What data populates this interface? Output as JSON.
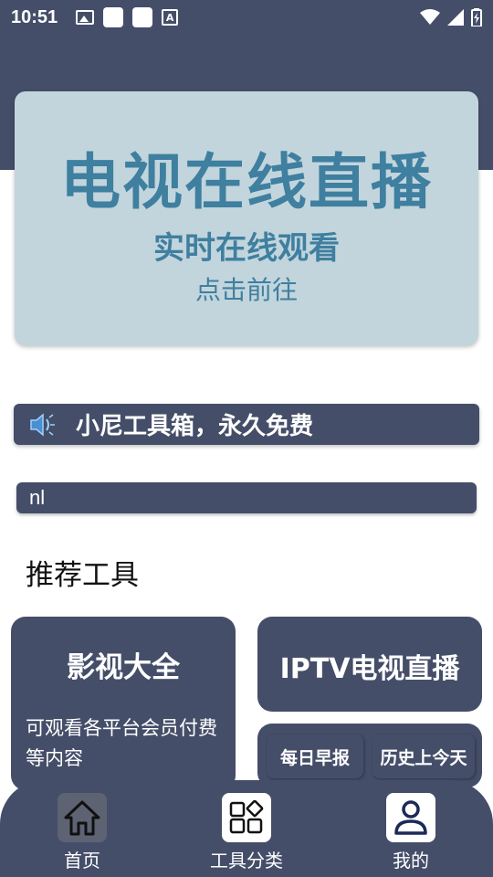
{
  "status_bar": {
    "time": "10:51",
    "left_icons": [
      "image-icon",
      "app-square-icon",
      "app-square-icon",
      "text-a-icon"
    ],
    "right_icons": [
      "wifi-icon",
      "signal-icon",
      "battery-icon"
    ]
  },
  "banner": {
    "title": "电视在线直播",
    "subtitle": "实时在线观看",
    "link": "点击前往"
  },
  "notice": {
    "icon": "speaker-icon",
    "text": "小尼工具箱，永久免费"
  },
  "nl_bar": {
    "text": "nl"
  },
  "section": {
    "title": "推荐工具"
  },
  "cards": {
    "movies": {
      "title": "影视大全",
      "desc": "可观看各平台会员付费等内容"
    },
    "iptv": {
      "title": "IPTV电视直播"
    },
    "daily": {
      "label": "每日早报"
    },
    "history": {
      "label": "历史上今天"
    }
  },
  "nav": {
    "items": [
      {
        "label": "首页",
        "icon": "home-icon",
        "active": true
      },
      {
        "label": "工具分类",
        "icon": "grid-icon",
        "active": false
      },
      {
        "label": "我的",
        "icon": "user-icon",
        "active": false
      }
    ]
  },
  "colors": {
    "primary": "#454e69",
    "banner_bg": "#c2d5dc",
    "banner_text": "#3f7fa0"
  }
}
